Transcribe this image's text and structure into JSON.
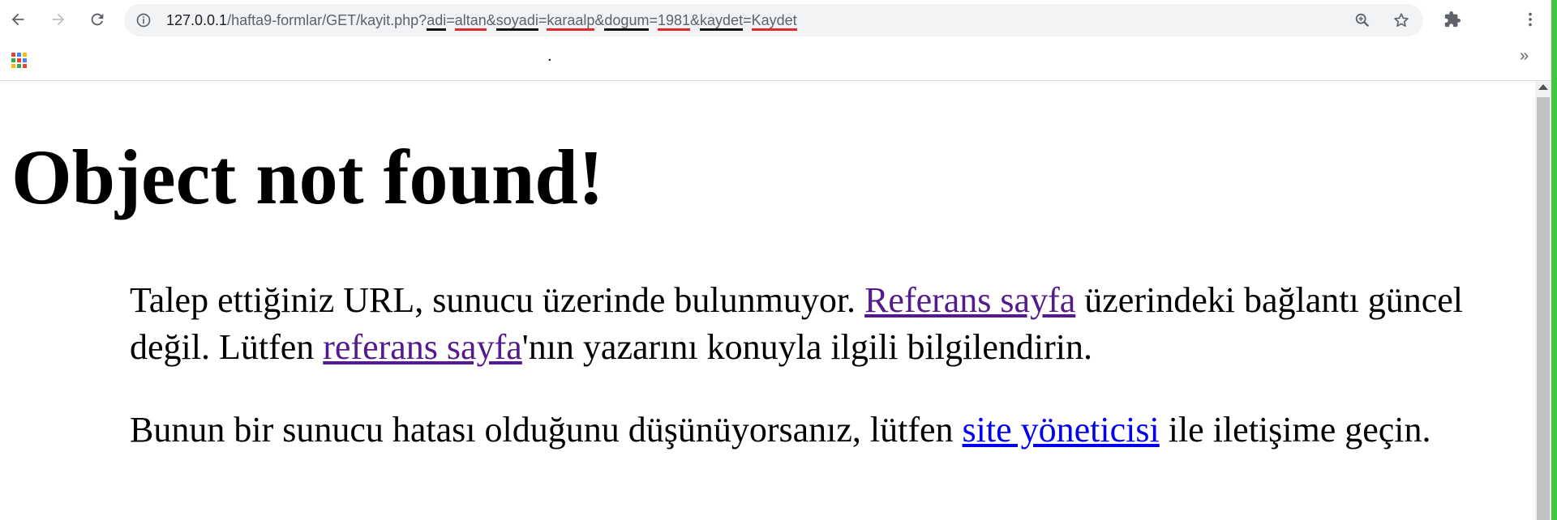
{
  "browser": {
    "address_bar": {
      "host": "127.0.0.1",
      "path": "/hafta9-formlar/GET/kayit.php?",
      "query": [
        {
          "key": "adi",
          "value": "altan"
        },
        {
          "key": "soyadi",
          "value": "karaalp"
        },
        {
          "key": "dogum",
          "value": "1981"
        },
        {
          "key": "kaydet",
          "value": "Kaydet"
        }
      ],
      "amp": "&",
      "eq": "="
    },
    "icons": {
      "back": "back-arrow-icon",
      "forward": "forward-arrow-icon",
      "reload": "reload-icon",
      "info": "info-icon",
      "zoom": "zoom-icon",
      "bookmark": "star-icon",
      "extensions": "puzzle-icon",
      "menu": "kebab-menu-icon",
      "apps": "apps-grid-icon"
    },
    "bookmarks_bar": {
      "dot": ".",
      "overflow": "»"
    }
  },
  "page": {
    "heading": "Object not found!",
    "p1": {
      "before_link1": "Talep ettiğiniz URL, sunucu üzerinde bulunmuyor. ",
      "link1": "Referans sayfa",
      "middle": " üzerindeki bağlantı güncel değil. Lütfen ",
      "link2": "referans sayfa",
      "after_link2": "'nın yazarını konuyla ilgili bilgilendirin."
    },
    "p2": {
      "before_link": "Bunun bir sunucu hatası olduğunu düşünüyorsanız, lütfen ",
      "link": "site yöneticisi",
      "after_link": " ile iletişime geçin."
    }
  },
  "colors": {
    "visited_link": "#551a8b",
    "link": "#0000ee",
    "red_underline": "#e0282e"
  }
}
